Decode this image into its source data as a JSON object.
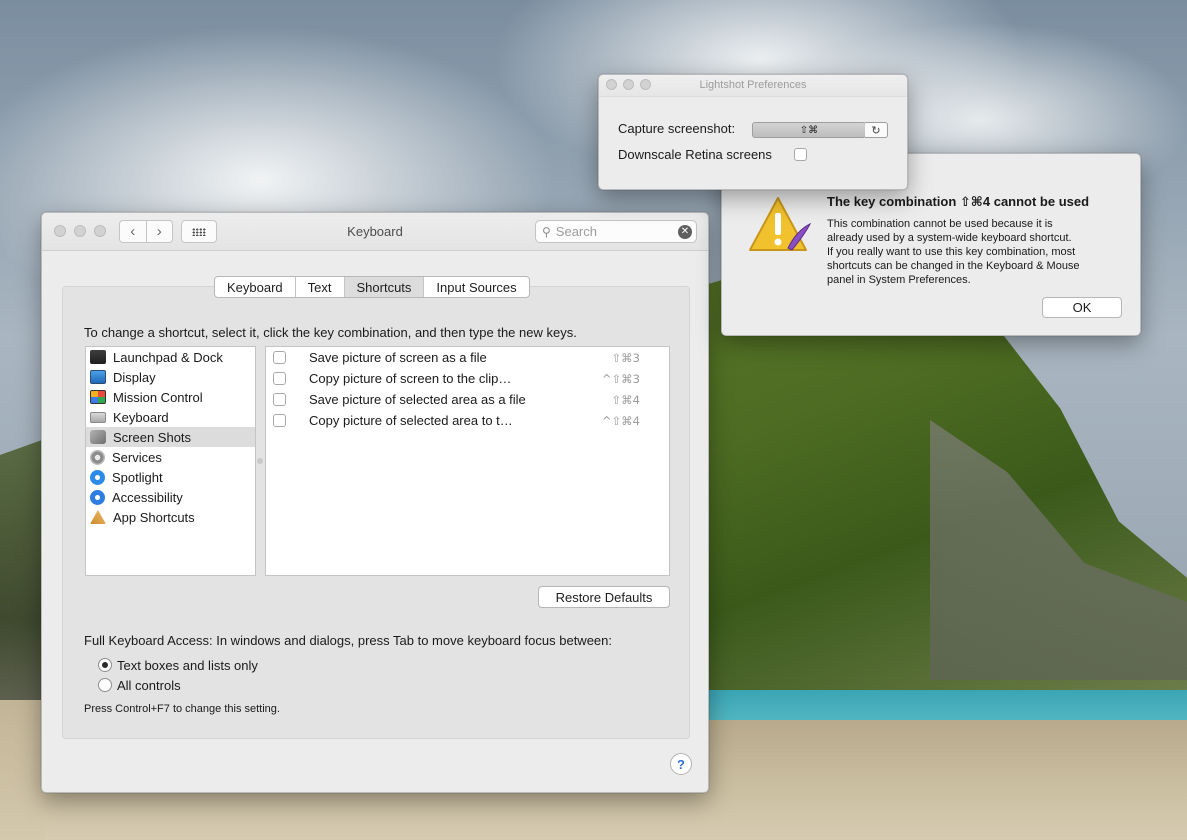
{
  "keyboard_window": {
    "title": "Keyboard",
    "nav_back": "‹",
    "nav_forward": "›",
    "search_placeholder": "Search",
    "tabs": [
      {
        "label": "Keyboard",
        "active": false
      },
      {
        "label": "Text",
        "active": false
      },
      {
        "label": "Shortcuts",
        "active": true
      },
      {
        "label": "Input Sources",
        "active": false
      }
    ],
    "instruction": "To change a shortcut, select it, click the key combination, and then type the new keys.",
    "categories": [
      {
        "label": "Launchpad & Dock",
        "icon": "launchpad-icon"
      },
      {
        "label": "Display",
        "icon": "display-icon"
      },
      {
        "label": "Mission Control",
        "icon": "mission-control-icon"
      },
      {
        "label": "Keyboard",
        "icon": "keyboard-icon"
      },
      {
        "label": "Screen Shots",
        "icon": "screenshots-icon",
        "selected": true
      },
      {
        "label": "Services",
        "icon": "services-icon"
      },
      {
        "label": "Spotlight",
        "icon": "spotlight-icon"
      },
      {
        "label": "Accessibility",
        "icon": "accessibility-icon"
      },
      {
        "label": "App Shortcuts",
        "icon": "app-shortcuts-icon"
      }
    ],
    "shortcuts": [
      {
        "label": "Save picture of screen as a file",
        "keys": "⇧⌘3",
        "checked": false
      },
      {
        "label": "Copy picture of screen to the clip…",
        "keys": "^⇧⌘3",
        "checked": false
      },
      {
        "label": "Save picture of selected area as a file",
        "keys": "⇧⌘4",
        "checked": false
      },
      {
        "label": "Copy picture of selected area to t…",
        "keys": "^⇧⌘4",
        "checked": false
      }
    ],
    "restore_defaults": "Restore Defaults",
    "full_keyboard_access": "Full Keyboard Access: In windows and dialogs, press Tab to move keyboard focus between:",
    "radio_options": [
      {
        "label": "Text boxes and lists only",
        "selected": true
      },
      {
        "label": "All controls",
        "selected": false
      }
    ],
    "hint": "Press Control+F7 to change this setting.",
    "help": "?"
  },
  "alert_dialog": {
    "title": "The key combination ⇧⌘4 cannot be used",
    "body_lines": [
      "This combination cannot be used because it is",
      "already used by a system-wide keyboard shortcut.",
      "If you really want to use this key combination, most",
      "shortcuts can be changed in the Keyboard & Mouse",
      "panel in System Preferences."
    ],
    "ok_label": "OK"
  },
  "lightshot_window": {
    "title": "Lightshot Preferences",
    "capture_label": "Capture screenshot:",
    "capture_value": "⇧⌘",
    "downscale_label": "Downscale Retina screens",
    "downscale_checked": false
  },
  "colors": {
    "window_bg": "#ececec",
    "selection": "#dcdcdc",
    "help_blue": "#2f6fd6",
    "warning_yellow": "#f2c12e"
  }
}
